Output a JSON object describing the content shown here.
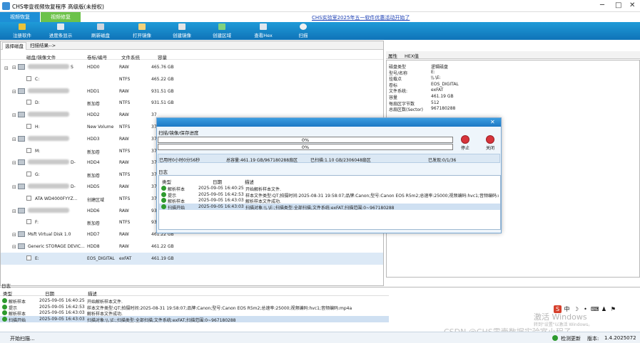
{
  "window": {
    "title": "CHS零壹视频恢复程序 高级版(未授权)",
    "min": "─",
    "max": "□",
    "close": "✕"
  },
  "mode_tabs": [
    "视频恢复",
    "视频修复"
  ],
  "promo": "CHS实验室2025年五一软件优惠活动开始了",
  "toolbar": [
    "注册软件",
    "进度条显示",
    "刷新磁盘",
    "打开镜像",
    "创建镜像",
    "创建区域",
    "查看Hex",
    "扫描"
  ],
  "panel_tabs": [
    "选择磁盘",
    "扫描结果-->"
  ],
  "disk_columns": [
    "磁盘/镜像文件",
    "卷标/编号",
    "文件系统",
    "容量"
  ],
  "disks": [
    {
      "name": "",
      "vol": "HDD0",
      "fs": "RAW",
      "cap": "465.76 GB",
      "kind": "disk",
      "suffix": "S"
    },
    {
      "name": "C:",
      "vol": "",
      "fs": "NTFS",
      "cap": "465.22 GB",
      "kind": "part"
    },
    {
      "name": "",
      "vol": "HDD1",
      "fs": "RAW",
      "cap": "931.51 GB",
      "kind": "disk"
    },
    {
      "name": "D:",
      "vol": "新加卷",
      "fs": "NTFS",
      "cap": "931.51 GB",
      "kind": "part"
    },
    {
      "name": "",
      "vol": "HDD2",
      "fs": "RAW",
      "cap": "37",
      "kind": "disk"
    },
    {
      "name": "H:",
      "vol": "New Volume",
      "fs": "NTFS",
      "cap": "37",
      "kind": "part"
    },
    {
      "name": "",
      "vol": "HDD3",
      "fs": "RAW",
      "cap": "37",
      "kind": "disk"
    },
    {
      "name": "M:",
      "vol": "新加卷",
      "fs": "NTFS",
      "cap": "37",
      "kind": "part"
    },
    {
      "name": "",
      "vol": "HDD4",
      "fs": "RAW",
      "cap": "37",
      "kind": "disk",
      "suffix": "D-"
    },
    {
      "name": "G:",
      "vol": "新加卷",
      "fs": "NTFS",
      "cap": "37",
      "kind": "part"
    },
    {
      "name": "",
      "vol": "HDD5",
      "fs": "RAW",
      "cap": "37",
      "kind": "disk",
      "suffix": "D-"
    },
    {
      "name": "ATA     WD4000FYYZ...",
      "vol": "创建区域",
      "fs": "NTFS",
      "cap": "37",
      "kind": "part"
    },
    {
      "name": "",
      "vol": "HDD6",
      "fs": "RAW",
      "cap": "931.50 GB",
      "kind": "disk"
    },
    {
      "name": "F:",
      "vol": "新加卷",
      "fs": "NTFS",
      "cap": "931.50 GB",
      "kind": "part"
    },
    {
      "name": "Msft    Virtual Disk    1.0",
      "vol": "HDD7",
      "fs": "RAW",
      "cap": "461.22 GB",
      "kind": "disk"
    },
    {
      "name": "Generic STORAGE DEVIC...",
      "vol": "HDD8",
      "fs": "RAW",
      "cap": "461.22 GB",
      "kind": "disk"
    },
    {
      "name": "E:",
      "vol": "EOS_DIGITAL",
      "fs": "exFAT",
      "cap": "461.19 GB",
      "kind": "part",
      "selected": true
    }
  ],
  "prop_tabs": [
    "属性",
    "HEX值"
  ],
  "props": [
    [
      "磁盘类型",
      "逻辑磁盘"
    ],
    [
      "型号/名称",
      "E:"
    ],
    [
      "挂载点",
      "\\\\.\\E:"
    ],
    [
      "卷标",
      "EOS_DIGITAL"
    ],
    [
      "文件系统:",
      "exFAT"
    ],
    [
      "容量",
      "461.19 GB"
    ],
    [
      "每扇区字节数",
      "512"
    ],
    [
      "总扇区数(Sector)",
      "967180288"
    ]
  ],
  "log": {
    "title": "日志",
    "columns": [
      "类型",
      "日期",
      "描述"
    ],
    "rows": [
      [
        "解析样本",
        "2025-09-05 16:40:25",
        "开始解析样本文件."
      ],
      [
        "提示",
        "2025-09-05 16:42:53",
        "样本文件类型:QT;拍摄时间:2025-08-31 19:58:07;品牌:Canon;型号:Canon EOS R5m2;总速率:25000;视频编码:hvc1;音频编码:mp4a"
      ],
      [
        "解析样本",
        "2025-09-05 16:43:03",
        "解析样本文件成功."
      ],
      [
        "扫描开始",
        "2025-09-05 16:43:03",
        "扫描对象:\\\\.\\E:;扫描类型:全部扫描;文件系统:exFAT;扫描范围:0~967180288"
      ]
    ]
  },
  "dialog": {
    "title": "扫描/镜像/保存进度",
    "pct1": "0%",
    "pct2": "0%",
    "stop": "停止",
    "close": "关闭",
    "elapsed": "已用时0小时0分56秒",
    "total": "总容量:461.19 GB/967180288扇区",
    "scanned": "已扫描:1.10 GB/2306048扇区",
    "found": "已发现:0/1/36",
    "log_title": "日志",
    "log_rows": [
      [
        "解析样本",
        "2025-09-05 16:40:25",
        "开始解析样本文件."
      ],
      [
        "提示",
        "2025-09-05 16:42:53",
        "样本文件类型:QT;拍摄时间:2025-08-31 19:58:07;品牌:Canon;型号:Canon EOS R5m2;总速率:25000;视频编码:hvc1;音频编码:mp"
      ],
      [
        "解析样本",
        "2025-09-05 16:43:03",
        "解析样本文件成功."
      ],
      [
        "扫描开始",
        "2025-09-05 16:43:03",
        "扫描对象:\\\\.\\E:;扫描类型:全部扫描;文件系统:exFAT;扫描范围:0~967180288"
      ]
    ]
  },
  "status": {
    "text": "开始扫描...",
    "right_label": "检测更新",
    "version_prefix": "版本:",
    "version": "1.4.2025072"
  },
  "ime": [
    "S",
    "中",
    "☽",
    "•",
    "⌨",
    "♟",
    "⚑"
  ],
  "watermarks": {
    "activate": "激活 Windows",
    "activate_sub": "转到\"设置\"以激活 Windows。",
    "csdn": "CSDN @CHS零壹数据实验室小程子"
  },
  "colors": {
    "toolbar": "#1789c9",
    "tab_recover": "#1e8fd6",
    "tab_repair": "#6cc24a",
    "progress": "#3a8fd6"
  }
}
